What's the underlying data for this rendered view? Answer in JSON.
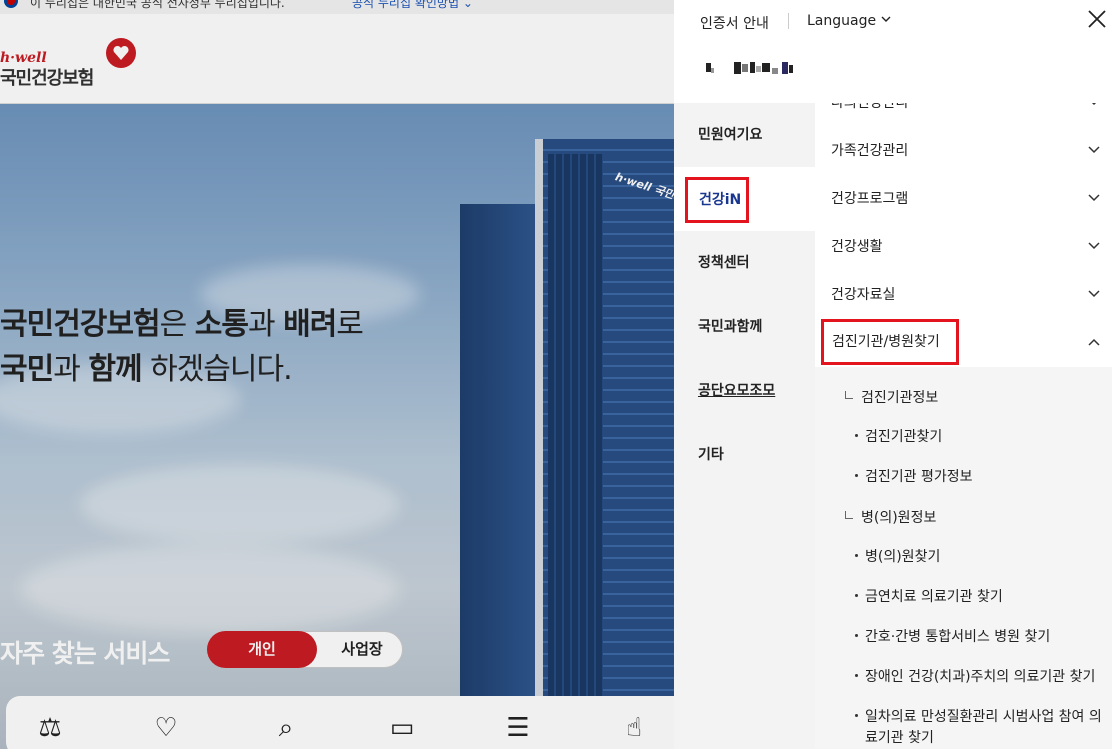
{
  "background": {
    "gov_notice": "이 누리집은 대한민국 공식 전자정부 누리집입니다.",
    "gov_check_link": "공식 누리집 확인방법",
    "logo": {
      "en": "h·well",
      "ko": "국민건강보험"
    },
    "hero": {
      "line1": [
        {
          "t": "국민건강보험",
          "b": true
        },
        {
          "t": "은 ",
          "b": false
        },
        {
          "t": "소통",
          "b": true
        },
        {
          "t": "과 ",
          "b": false
        },
        {
          "t": "배려",
          "b": true
        },
        {
          "t": "로",
          "b": false
        }
      ],
      "line2": [
        {
          "t": "국민",
          "b": true
        },
        {
          "t": "과 ",
          "b": false
        },
        {
          "t": "함께",
          "b": true
        },
        {
          "t": " 하겠습니다.",
          "b": false
        }
      ],
      "building_sign": "h·well 국민건"
    },
    "services": {
      "title": "자주 찾는 서비스",
      "tab_personal": "개인",
      "tab_business": "사업장"
    },
    "quick_icons": [
      "scale-icon",
      "heart-person-icon",
      "heart-search-icon",
      "monitor-won-icon",
      "receipt-heart-icon",
      "calculator-hand-icon"
    ]
  },
  "drawer": {
    "cert_link": "인증서 안내",
    "language": "Language",
    "close_icon": "close-icon",
    "main_menu": [
      {
        "label": "민원여기요",
        "active": false
      },
      {
        "label": "건강iN",
        "active": true
      },
      {
        "label": "정책센터",
        "active": false
      },
      {
        "label": "국민과함께",
        "active": false
      },
      {
        "label": "공단요모조모",
        "active": false,
        "underline": true
      },
      {
        "label": "기타",
        "active": false
      }
    ],
    "sub_menu": [
      {
        "label": "나의건강관리",
        "expanded": false
      },
      {
        "label": "가족건강관리",
        "expanded": false
      },
      {
        "label": "건강프로그램",
        "expanded": false
      },
      {
        "label": "건강생활",
        "expanded": false
      },
      {
        "label": "건강자료실",
        "expanded": false
      },
      {
        "label": "검진기관/병원찾기",
        "expanded": true
      }
    ],
    "expanded": {
      "group1": {
        "title": "검진기관정보",
        "items": [
          "검진기관찾기",
          "검진기관 평가정보"
        ]
      },
      "group2": {
        "title": "병(의)원정보",
        "items": [
          "병(의)원찾기",
          "금연치료 의료기관 찾기",
          "간호·간병 통합서비스 병원 찾기",
          "장애인 건강(치과)주치의 의료기관 찾기",
          "일차의료 만성질환관리 시범사업 참여 의료기관 찾기"
        ]
      }
    }
  },
  "colors": {
    "brand_red": "#c91c24",
    "highlight_red": "#e4141e",
    "active_blue": "#1a3790"
  }
}
